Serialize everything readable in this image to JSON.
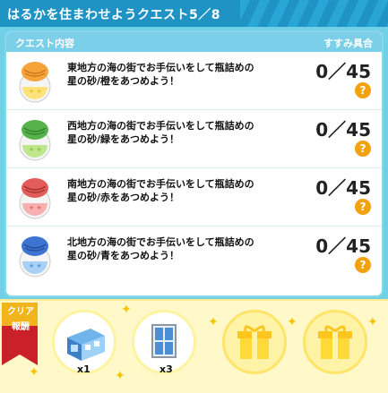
{
  "window": {
    "title": "はるかを住まわせようクエスト5／8"
  },
  "table": {
    "col_left": "クエスト内容",
    "col_right": "すすみ具合"
  },
  "quests": [
    {
      "desc": "東地方の海の街でお手伝いをして瓶詰めの星の砂/橙をあつめよう！",
      "progress": "0／45",
      "help": "?",
      "icon": "orange-star-sand-bottle-icon",
      "color": "#f6a33b"
    },
    {
      "desc": "西地方の海の街でお手伝いをして瓶詰めの星の砂/緑をあつめよう！",
      "progress": "0／45",
      "help": "?",
      "icon": "green-star-sand-bottle-icon",
      "color": "#56b34b"
    },
    {
      "desc": "南地方の海の街でお手伝いをして瓶詰めの星の砂/赤をあつめよう！",
      "progress": "0／45",
      "help": "?",
      "icon": "red-star-sand-bottle-icon",
      "color": "#e25c5c"
    },
    {
      "desc": "北地方の海の街でお手伝いをして瓶詰めの星の砂/青をあつめよう！",
      "progress": "0／45",
      "help": "?",
      "icon": "blue-star-sand-bottle-icon",
      "color": "#3d74d1"
    }
  ],
  "rewards": {
    "badge_line1": "クリア",
    "badge_line2": "報酬",
    "items": [
      {
        "icon": "aquarium-building-icon",
        "count": "x1"
      },
      {
        "icon": "glass-window-icon",
        "count": "x3"
      },
      {
        "icon": "gift-box-icon",
        "count": ""
      },
      {
        "icon": "gift-box-icon",
        "count": ""
      }
    ]
  }
}
